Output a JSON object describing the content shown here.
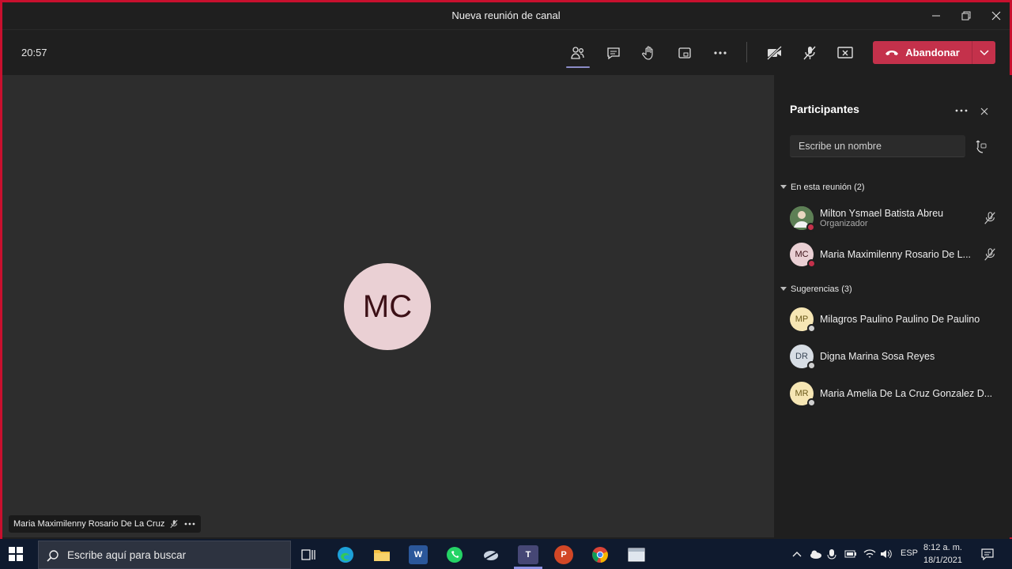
{
  "window": {
    "title": "Nueva reunión de canal"
  },
  "toolbar": {
    "elapsed": "20:57",
    "leave_label": "Abandonar"
  },
  "stage": {
    "avatar_initials": "MC",
    "speaker_name": "Maria Maximilenny Rosario De La Cruz"
  },
  "panel": {
    "title": "Participantes",
    "search_placeholder": "Escribe un nombre",
    "in_meeting_label": "En esta reunión (2)",
    "suggestions_label": "Sugerencias (3)",
    "in_meeting": [
      {
        "name": "Milton Ysmael Batista Abreu",
        "role": "Organizador",
        "initials": "",
        "avatar_color": "#6b8f5e",
        "status_color": "#c4314b"
      },
      {
        "name": "Maria Maximilenny Rosario De L...",
        "role": "",
        "initials": "MC",
        "avatar_color": "#ead0d4",
        "status_color": "#c4314b"
      }
    ],
    "suggestions": [
      {
        "name": "Milagros Paulino Paulino De Paulino",
        "initials": "MP",
        "avatar_color": "#f6e6b4"
      },
      {
        "name": "Digna Marina Sosa Reyes",
        "initials": "DR",
        "avatar_color": "#d7dde4"
      },
      {
        "name": "Maria Amelia De La Cruz Gonzalez D...",
        "initials": "MR",
        "avatar_color": "#f6e6b4"
      }
    ]
  },
  "taskbar": {
    "search_placeholder": "Escribe aquí para buscar",
    "language": "ESP",
    "time": "8:12 a. m.",
    "date": "18/1/2021"
  }
}
